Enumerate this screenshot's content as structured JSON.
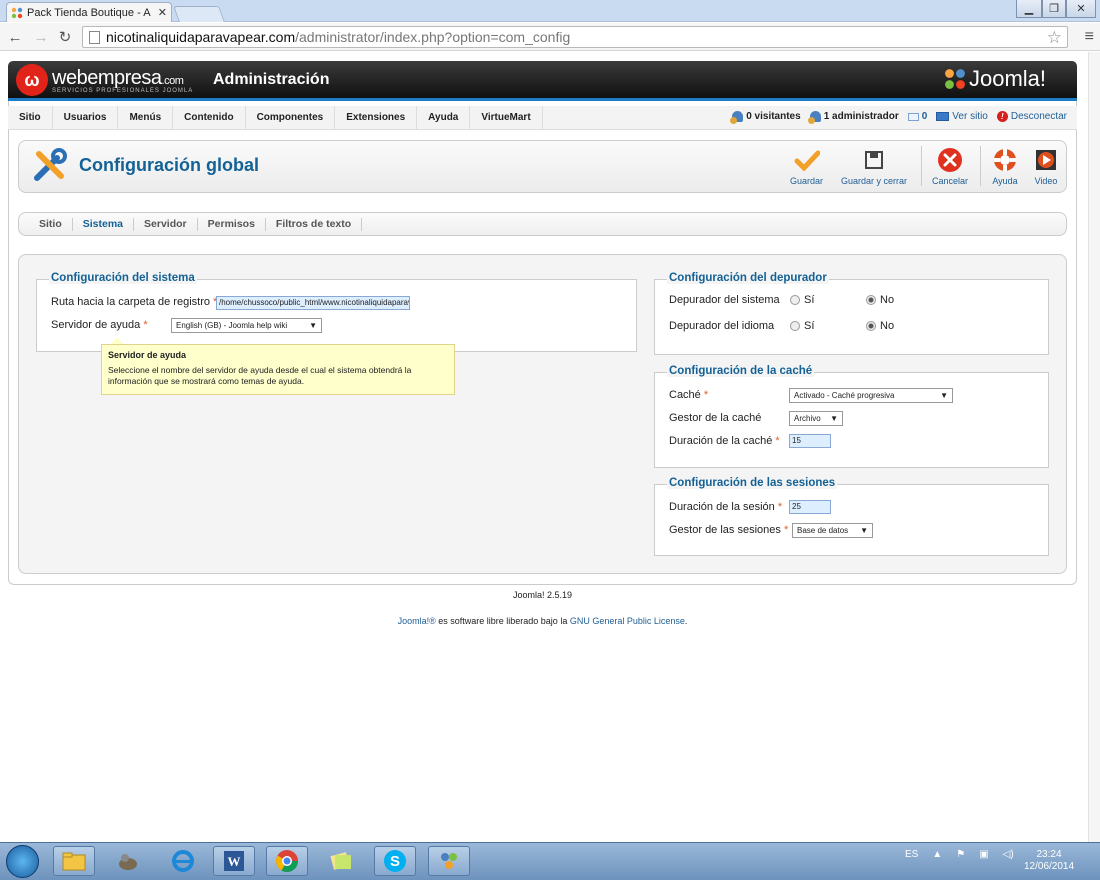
{
  "browser": {
    "tab_title": "Pack Tienda Boutique - A",
    "url_host": "nicotinaliquidaparavapear.com",
    "url_path": "/administrator/index.php?option=com_config"
  },
  "header": {
    "brand": "webempresa",
    "brand_suffix": ".com",
    "brand_sub": "SERVICIOS PROFESIONALES JOOMLA",
    "admin_title": "Administración",
    "joomla": "Joomla!"
  },
  "menu": [
    "Sitio",
    "Usuarios",
    "Menús",
    "Contenido",
    "Componentes",
    "Extensiones",
    "Ayuda",
    "VirtueMart"
  ],
  "status": {
    "visitors": "0 visitantes",
    "admins": "1 administrador",
    "messages": "0",
    "view_site": "Ver sitio",
    "logout": "Desconectar"
  },
  "toolbar": {
    "title": "Configuración global",
    "save": "Guardar",
    "save_close": "Guardar y cerrar",
    "cancel": "Cancelar",
    "help": "Ayuda",
    "video": "Video"
  },
  "subtabs": [
    "Sitio",
    "Sistema",
    "Servidor",
    "Permisos",
    "Filtros de texto"
  ],
  "active_subtab": "Sistema",
  "system": {
    "legend": "Configuración del sistema",
    "log_label": "Ruta hacia la carpeta de registro",
    "log_value": "/home/chussoco/public_html/www.nicotinaliquidaparavapear.com/logs",
    "help_label": "Servidor de ayuda",
    "help_value": "English (GB) - Joomla help wiki"
  },
  "tooltip": {
    "title": "Servidor de ayuda",
    "text": "Seleccione el nombre del servidor de ayuda desde el cual el sistema obtendrá la información que se mostrará como temas de ayuda."
  },
  "debug": {
    "legend": "Configuración del depurador",
    "system_label": "Depurador del sistema",
    "lang_label": "Depurador del idioma",
    "yes": "Sí",
    "no": "No"
  },
  "cache": {
    "legend": "Configuración de la caché",
    "cache_label": "Caché",
    "cache_value": "Activado - Caché progresiva",
    "handler_label": "Gestor de la caché",
    "handler_value": "Archivo",
    "time_label": "Duración de la caché",
    "time_value": "15"
  },
  "session": {
    "legend": "Configuración de las sesiones",
    "time_label": "Duración de la sesión",
    "time_value": "25",
    "handler_label": "Gestor de las sesiones",
    "handler_value": "Base de datos"
  },
  "footer": {
    "version": "Joomla! 2.5.19",
    "license_link1": "Joomla!®",
    "license_mid": " es software libre liberado bajo la ",
    "license_link2": "GNU General Public License",
    "license_end": "."
  },
  "taskbar": {
    "lang": "ES",
    "time": "23:24",
    "date": "12/06/2014"
  },
  "colors": {
    "accent": "#146295",
    "joomla_blue": "#1c7cc4",
    "required": "#e05b2a"
  }
}
